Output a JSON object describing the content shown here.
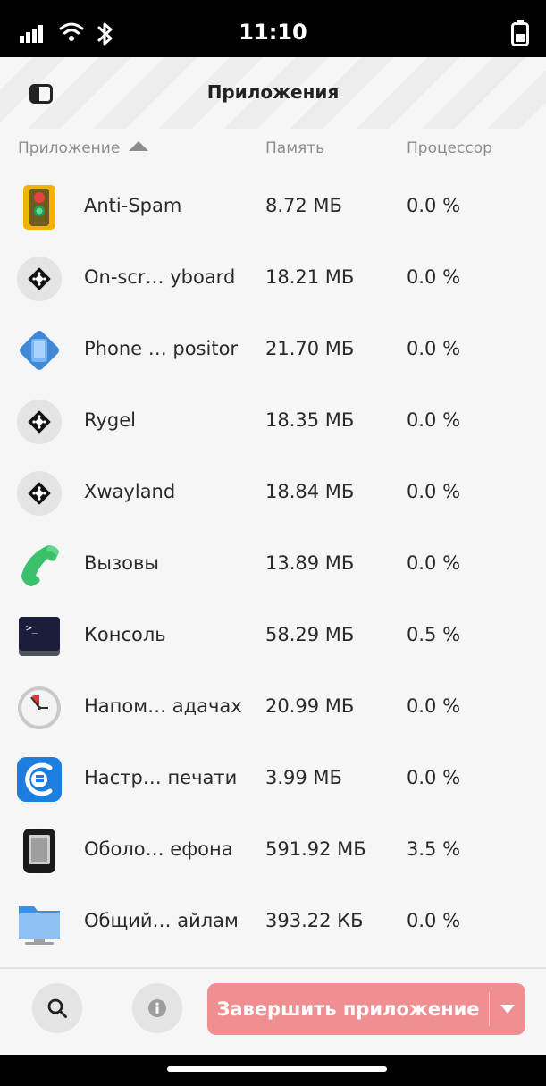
{
  "status_bar": {
    "time": "11:10",
    "icons": [
      "signal-icon",
      "wifi-icon",
      "bluetooth-icon",
      "battery-icon"
    ]
  },
  "header": {
    "title": "Приложения",
    "sidebar_icon": "sidebar-toggle-icon"
  },
  "columns": {
    "app": "Приложение",
    "memory": "Память",
    "cpu": "Процессор",
    "sort_icon": "sort-ascending-icon"
  },
  "apps": [
    {
      "name": "Anti-Spam",
      "memory": "8.72 МБ",
      "cpu": "0.0 %",
      "icon": "traffic-light-icon"
    },
    {
      "name": "On-scr… yboard",
      "memory": "18.21 МБ",
      "cpu": "0.0 %",
      "icon": "generic-app-icon"
    },
    {
      "name": "Phone … positor",
      "memory": "21.70 МБ",
      "cpu": "0.0 %",
      "icon": "phone-compositor-icon"
    },
    {
      "name": "Rygel",
      "memory": "18.35 МБ",
      "cpu": "0.0 %",
      "icon": "generic-app-icon"
    },
    {
      "name": "Xwayland",
      "memory": "18.84 МБ",
      "cpu": "0.0 %",
      "icon": "generic-app-icon"
    },
    {
      "name": "Вызовы",
      "memory": "13.89 МБ",
      "cpu": "0.0 %",
      "icon": "phone-handset-icon"
    },
    {
      "name": "Консоль",
      "memory": "58.29 МБ",
      "cpu": "0.5 %",
      "icon": "terminal-icon"
    },
    {
      "name": "Напом… адачах",
      "memory": "20.99 МБ",
      "cpu": "0.0 %",
      "icon": "clock-icon"
    },
    {
      "name": "Настр… печати",
      "memory": "3.99 МБ",
      "cpu": "0.0 %",
      "icon": "printer-settings-icon"
    },
    {
      "name": "Оболо… ефона",
      "memory": "591.92 МБ",
      "cpu": "3.5 %",
      "icon": "phone-shell-icon"
    },
    {
      "name": "Общий… айлам",
      "memory": "393.22 КБ",
      "cpu": "0.0 %",
      "icon": "folder-share-icon"
    }
  ],
  "footer": {
    "search_icon": "search-icon",
    "info_icon": "info-icon",
    "end_button_label": "Завершить приложение",
    "dropdown_icon": "chevron-down-icon"
  },
  "colors": {
    "accent_destructive": "#ef8f92",
    "background": "#f6f6f6",
    "text": "#2a2a2a",
    "muted": "#8d8d8d"
  }
}
